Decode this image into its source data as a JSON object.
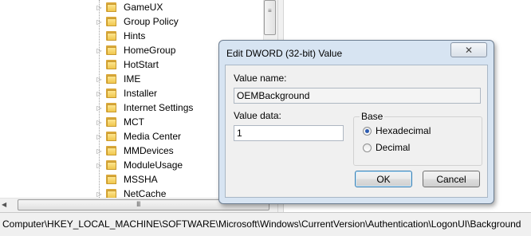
{
  "tree": {
    "items": [
      {
        "label": "GameUX"
      },
      {
        "label": "Group Policy"
      },
      {
        "label": "Hints"
      },
      {
        "label": "HomeGroup"
      },
      {
        "label": "HotStart"
      },
      {
        "label": "IME"
      },
      {
        "label": "Installer"
      },
      {
        "label": "Internet Settings"
      },
      {
        "label": "MCT"
      },
      {
        "label": "Media Center"
      },
      {
        "label": "MMDevices"
      },
      {
        "label": "ModuleUsage"
      },
      {
        "label": "MSSHA"
      },
      {
        "label": "NetCache"
      }
    ],
    "expander_glyph": "▷",
    "vscroll_grip": "≡",
    "hscroll_grip": "III",
    "hscroll_left_arrow": "◀"
  },
  "status_bar": {
    "path": "Computer\\HKEY_LOCAL_MACHINE\\SOFTWARE\\Microsoft\\Windows\\CurrentVersion\\Authentication\\LogonUI\\Background"
  },
  "dialog": {
    "title": "Edit DWORD (32-bit) Value",
    "close_glyph": "✕",
    "value_name_label": "Value name:",
    "value_name": "OEMBackground",
    "value_data_label": "Value data:",
    "value_data": "1",
    "base_label": "Base",
    "base_options": [
      {
        "label": "Hexadecimal",
        "selected": true
      },
      {
        "label": "Decimal",
        "selected": false
      }
    ],
    "ok_label": "OK",
    "cancel_label": "Cancel"
  },
  "colors": {
    "dialog_frame": "#d7e4f2",
    "folder": "#f0c74e",
    "radio_selected": "#2d5bb0"
  }
}
